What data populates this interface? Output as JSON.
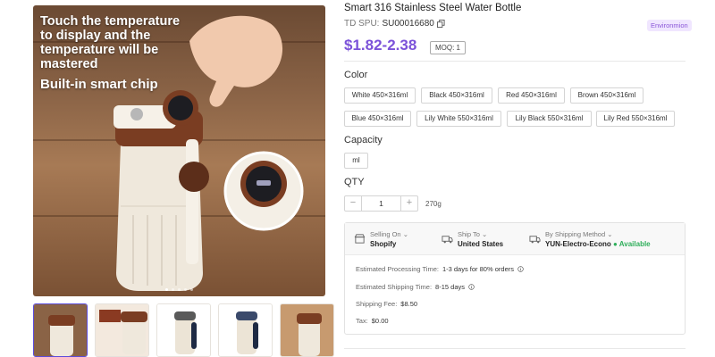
{
  "product": {
    "title": "Smart 316 Stainless Steel Water Bottle",
    "spu_label": "TD SPU:",
    "spu_value": "SU00016680",
    "tag": "Environmion",
    "price": "$1.82-2.38",
    "moq": "MOQ: 1"
  },
  "gallery": {
    "promo_text": "Touch the temperature\nto display and the\ntemperature will be\nmastered",
    "promo_sub": "Built-in smart chip",
    "dot_count": 5,
    "active_dot": 0,
    "thumbnail_count": 5,
    "active_thumbnail": 0
  },
  "color": {
    "label": "Color",
    "options": [
      "White 450×316ml",
      "Black 450×316ml",
      "Red 450×316ml",
      "Brown 450×316ml",
      "Blue 450×316ml",
      "Lily White 550×316ml",
      "Lily Black 550×316ml",
      "Lily Red 550×316ml"
    ]
  },
  "capacity": {
    "label": "Capacity",
    "options": [
      "ml"
    ]
  },
  "qty": {
    "label": "QTY",
    "minus": "−",
    "plus": "+",
    "value": "1",
    "weight": "270g"
  },
  "shipping": {
    "sell_on_label": "Selling On",
    "sell_on_value": "Shopify",
    "ship_to_label": "Ship To",
    "ship_to_value": "United States",
    "method_label": "By Shipping Method",
    "method_value": "YUN-Electro-Econo",
    "method_status": "Available",
    "processing_label": "Estimated Processing Time:",
    "processing_value": "1-3 days for 80% orders",
    "shipping_time_label": "Estimated Shipping Time:",
    "shipping_time_value": "8-15 days",
    "fee_label": "Shipping Fee:",
    "fee_value": "$8.50",
    "tax_label": "Tax:",
    "tax_value": "$0.00"
  },
  "colors": {
    "accent": "#7b52d9",
    "available": "#2eae5a"
  }
}
